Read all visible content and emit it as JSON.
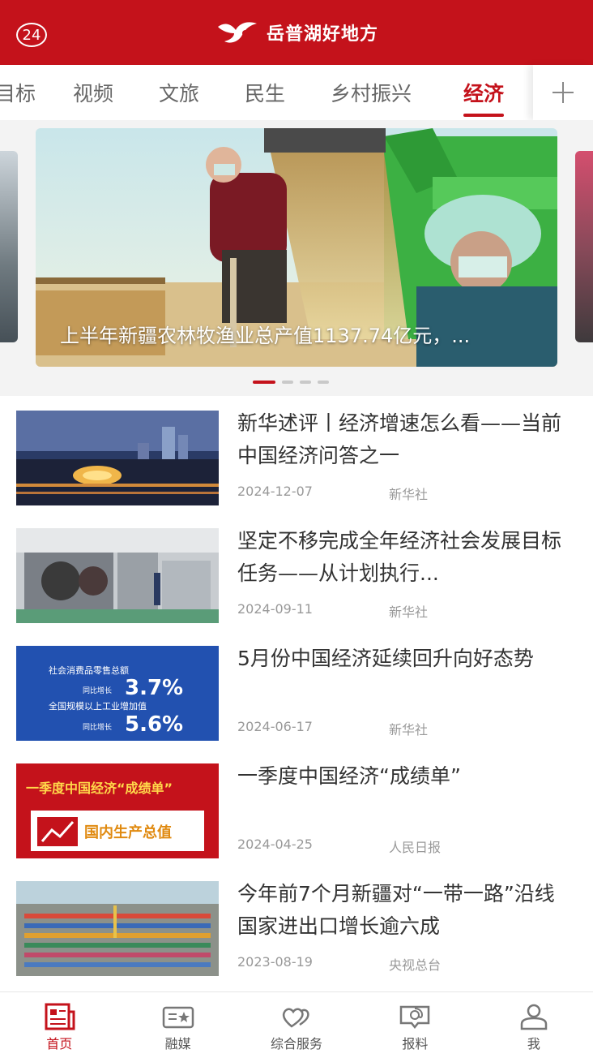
{
  "header": {
    "badge": "24",
    "brand": "岳普湖好地方",
    "colors": {
      "brand_red": "#c4121b"
    }
  },
  "tabs": [
    {
      "label": "目标",
      "active": false
    },
    {
      "label": "视频",
      "active": false
    },
    {
      "label": "文旅",
      "active": false
    },
    {
      "label": "民生",
      "active": false
    },
    {
      "label": "乡村振兴",
      "active": false
    },
    {
      "label": "经济",
      "active": true
    }
  ],
  "tabs_add_icon": "plus-icon",
  "carousel": {
    "caption": "上半年新疆农林牧渔业总产值1137.74亿元，...",
    "active_index": 0,
    "slide_count": 4
  },
  "news": [
    {
      "title": "新华述评丨经济增速怎么看——当前中国经济问答之一",
      "date": "2024-12-07",
      "source": "新华社"
    },
    {
      "title": "坚定不移完成全年经济社会发展目标任务——从计划执行...",
      "date": "2024-09-11",
      "source": "新华社"
    },
    {
      "title": "5月份中国经济延续回升向好态势",
      "date": "2024-06-17",
      "source": "新华社",
      "thumb_text": {
        "line1": "社会消费品零售总额",
        "line1_sub": "同比增长",
        "line1_value": "3.7%",
        "line2": "全国规模以上工业增加值",
        "line2_sub": "同比增长",
        "line2_value": "5.6%"
      }
    },
    {
      "title": "一季度中国经济“成绩单”",
      "date": "2024-04-25",
      "source": "人民日报",
      "thumb_text": {
        "banner": "一季度中国经济“成绩单”",
        "label": "国内生产总值"
      }
    },
    {
      "title": "今年前7个月新疆对“一带一路”沿线国家进出口增长逾六成",
      "date": "2023-08-19",
      "source": "央视总台"
    }
  ],
  "bottom_nav": [
    {
      "label": "首页",
      "icon": "newspaper-icon",
      "active": true
    },
    {
      "label": "融媒",
      "icon": "media-card-icon",
      "active": false
    },
    {
      "label": "综合服务",
      "icon": "hearts-icon",
      "active": false
    },
    {
      "label": "报料",
      "icon": "chat-at-icon",
      "active": false
    },
    {
      "label": "我",
      "icon": "user-icon",
      "active": false
    }
  ]
}
